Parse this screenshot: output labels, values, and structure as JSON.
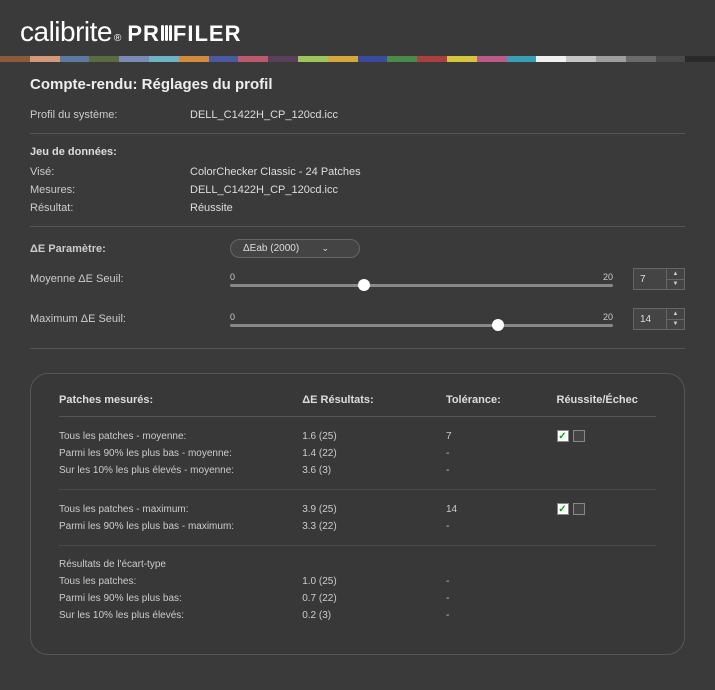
{
  "logo": {
    "brand": "calibrite",
    "product": "PROFILER"
  },
  "title": "Compte-rendu: Réglages du profil",
  "system_profile": {
    "label": "Profil du système:",
    "value": "DELL_C1422H_CP_120cd.icc"
  },
  "dataset": {
    "section": "Jeu de données:",
    "target": {
      "label": "Visé:",
      "value": "ColorChecker Classic - 24 Patches"
    },
    "measures": {
      "label": "Mesures:",
      "value": "DELL_C1422H_CP_120cd.icc"
    },
    "result": {
      "label": "Résultat:",
      "value": "Réussite"
    }
  },
  "de_param": {
    "section": "ΔE Paramètre:",
    "select_value": "ΔEab (2000)",
    "avg": {
      "label": "Moyenne ΔE Seuil:",
      "min": "0",
      "max": "20",
      "value": "7",
      "pct": 35
    },
    "max": {
      "label": "Maximum ΔE Seuil:",
      "min": "0",
      "max": "20",
      "value": "14",
      "pct": 70
    }
  },
  "results": {
    "headers": {
      "patches": "Patches mesurés:",
      "de": "ΔE Résultats:",
      "tol": "Tolérance:",
      "pf": "Réussite/Échec"
    },
    "group1": {
      "rows": [
        {
          "patches": "Tous les patches - moyenne:",
          "de": "1.6 (25)",
          "tol": "7",
          "pass": true
        },
        {
          "patches": "Parmi les 90% les plus bas - moyenne:",
          "de": "1.4 (22)",
          "tol": "-"
        },
        {
          "patches": "Sur les 10% les plus élevés - moyenne:",
          "de": "3.6 (3)",
          "tol": "-"
        }
      ]
    },
    "group2": {
      "rows": [
        {
          "patches": "Tous les patches - maximum:",
          "de": "3.9 (25)",
          "tol": "14",
          "pass": true
        },
        {
          "patches": "Parmi les 90% les plus bas - maximum:",
          "de": "3.3 (22)",
          "tol": "-"
        }
      ]
    },
    "group3": {
      "heading": "Résultats de l'écart-type",
      "rows": [
        {
          "patches": "Tous les patches:",
          "de": "1.0 (25)",
          "tol": "-"
        },
        {
          "patches": "Parmi les 90% les plus bas:",
          "de": "0.7 (22)",
          "tol": "-"
        },
        {
          "patches": "Sur les 10% les plus élevés:",
          "de": "0.2 (3)",
          "tol": "-"
        }
      ]
    }
  },
  "color_strip": [
    "#8b5a3c",
    "#d4987b",
    "#5b7a9e",
    "#5a6b3f",
    "#7a8bb5",
    "#6db5c5",
    "#d48a3c",
    "#4a5a9e",
    "#bb5a6b",
    "#5a3f5a",
    "#9ec55a",
    "#d4a83c",
    "#3a4a9e",
    "#4a8b4a",
    "#aa3f3f",
    "#d4c53c",
    "#bb5a8b",
    "#3a9eb5",
    "#f0f0f0",
    "#c5c5c5",
    "#9e9e9e",
    "#6b6b6b",
    "#4a4a4a",
    "#2a2a2a"
  ]
}
